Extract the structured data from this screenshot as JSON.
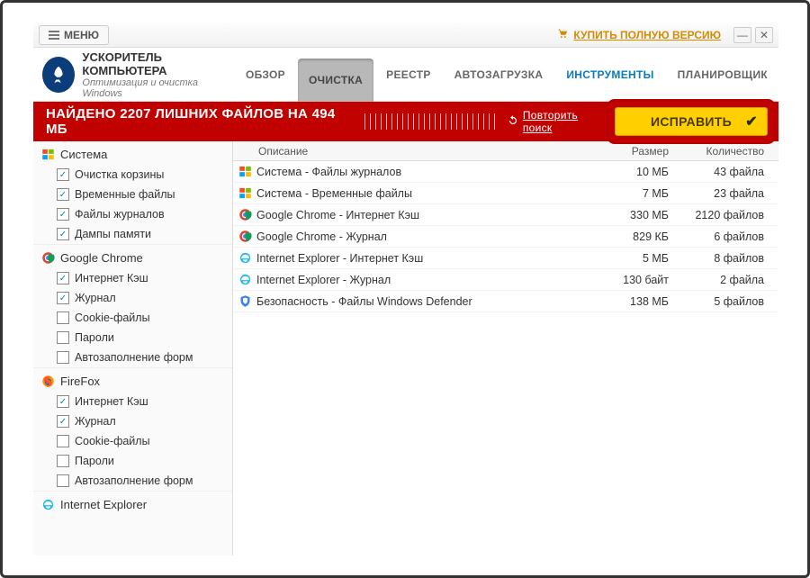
{
  "titlebar": {
    "menu_label": "МЕНЮ",
    "buy_label": "КУПИТЬ ПОЛНУЮ ВЕРСИЮ"
  },
  "logo": {
    "title": "УСКОРИТЕЛЬ КОМПЬЮТЕРА",
    "subtitle": "Оптимизация и очистка Windows"
  },
  "nav": {
    "overview": "ОБЗОР",
    "clean": "ОЧИСТКА",
    "registry": "РЕЕСТР",
    "startup": "АВТОЗАГРУЗКА",
    "tools": "ИНСТРУМЕНТЫ",
    "scheduler": "ПЛАНИРОВЩИК"
  },
  "status": {
    "text": "НАЙДЕНО 2207 ЛИШНИХ ФАЙЛОВ НА 494 МБ",
    "repeat": "Повторить поиск",
    "fix": "ИСПРАВИТЬ"
  },
  "sidebar": {
    "groups": [
      {
        "label": "Система",
        "icon": "windows",
        "items": [
          {
            "label": "Очистка корзины",
            "checked": true
          },
          {
            "label": "Временные файлы",
            "checked": true
          },
          {
            "label": "Файлы журналов",
            "checked": true
          },
          {
            "label": "Дампы памяти",
            "checked": true
          }
        ]
      },
      {
        "label": "Google Chrome",
        "icon": "chrome",
        "items": [
          {
            "label": "Интернет Кэш",
            "checked": true
          },
          {
            "label": "Журнал",
            "checked": true
          },
          {
            "label": "Cookie-файлы",
            "checked": false
          },
          {
            "label": "Пароли",
            "checked": false
          },
          {
            "label": "Автозаполнение форм",
            "checked": false
          }
        ]
      },
      {
        "label": "FireFox",
        "icon": "firefox",
        "items": [
          {
            "label": "Интернет Кэш",
            "checked": true
          },
          {
            "label": "Журнал",
            "checked": true
          },
          {
            "label": "Cookie-файлы",
            "checked": false
          },
          {
            "label": "Пароли",
            "checked": false
          },
          {
            "label": "Автозаполнение форм",
            "checked": false
          }
        ]
      },
      {
        "label": "Internet Explorer",
        "icon": "ie",
        "items": []
      }
    ]
  },
  "table": {
    "headers": {
      "desc": "Описание",
      "size": "Размер",
      "count": "Количество"
    },
    "rows": [
      {
        "icon": "windows",
        "desc": "Система - Файлы журналов",
        "size": "10 МБ",
        "count": "43 файла"
      },
      {
        "icon": "windows",
        "desc": "Система - Временные файлы",
        "size": "7 МБ",
        "count": "23 файла"
      },
      {
        "icon": "chrome",
        "desc": "Google Chrome - Интернет Кэш",
        "size": "330 МБ",
        "count": "2120 файлов"
      },
      {
        "icon": "chrome",
        "desc": "Google Chrome - Журнал",
        "size": "829 КБ",
        "count": "6 файлов"
      },
      {
        "icon": "ie",
        "desc": "Internet Explorer - Интернет Кэш",
        "size": "5 МБ",
        "count": "8 файлов"
      },
      {
        "icon": "ie",
        "desc": "Internet Explorer - Журнал",
        "size": "130 байт",
        "count": "2 файла"
      },
      {
        "icon": "shield",
        "desc": "Безопасность - Файлы Windows Defender",
        "size": "138 МБ",
        "count": "5 файлов"
      }
    ]
  }
}
